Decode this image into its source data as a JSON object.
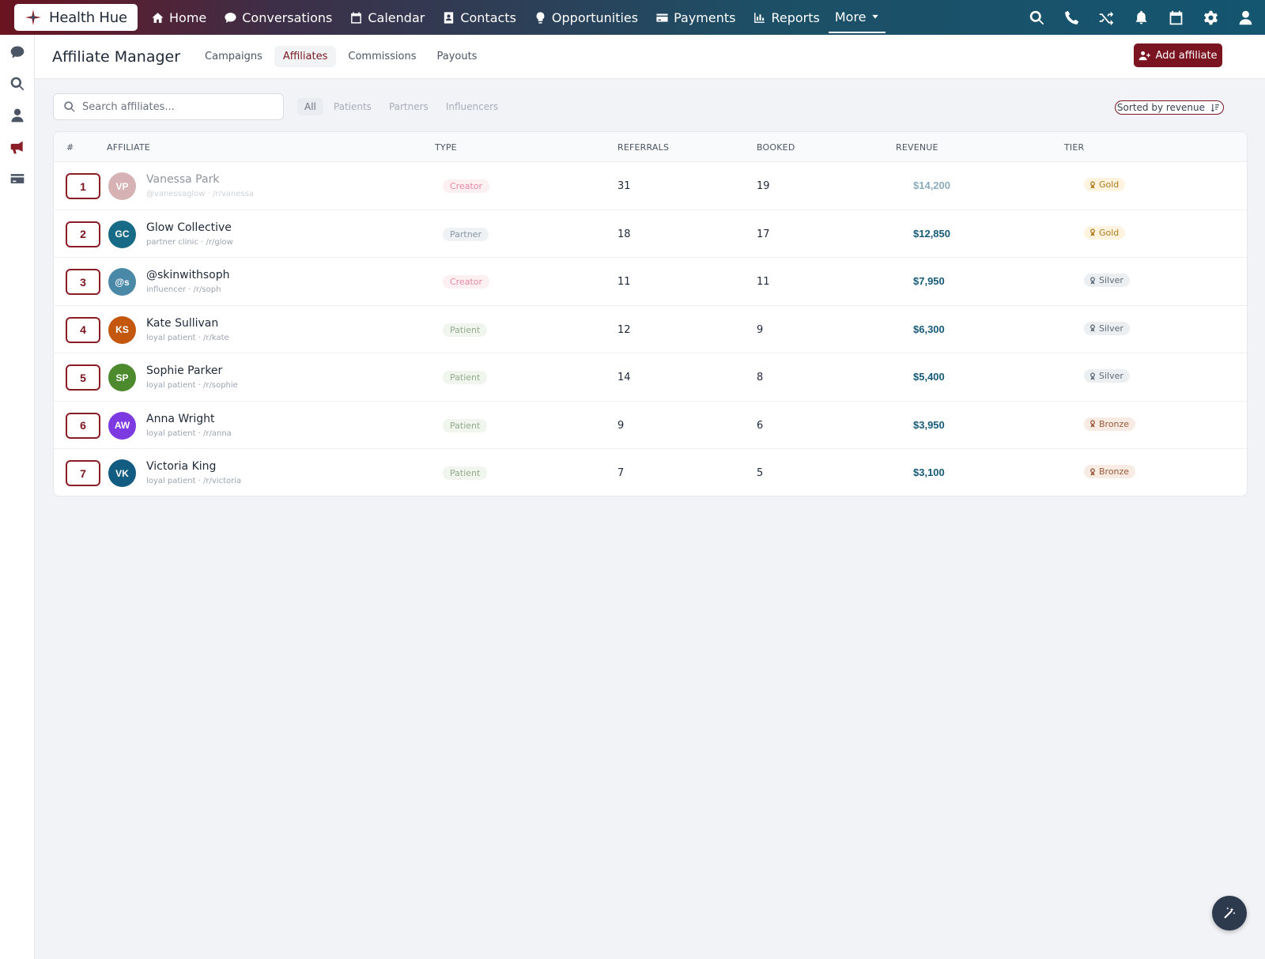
{
  "app": {
    "brand": "Health Hue",
    "accent": "#7a1420"
  },
  "nav": {
    "items": [
      {
        "label": "Home",
        "icon": "home-icon"
      },
      {
        "label": "Conversations",
        "icon": "chat-icon"
      },
      {
        "label": "Calendar",
        "icon": "calendar-icon"
      },
      {
        "label": "Contacts",
        "icon": "contact-card-icon"
      },
      {
        "label": "Opportunities",
        "icon": "lightbulb-icon"
      },
      {
        "label": "Payments",
        "icon": "credit-card-icon"
      },
      {
        "label": "Reports",
        "icon": "bar-chart-icon"
      }
    ],
    "more": "More",
    "right_icons": [
      "search-icon",
      "phone-icon",
      "shuffle-icon",
      "bell-icon",
      "calendar-icon",
      "gear-icon",
      "user-icon"
    ]
  },
  "siderail": {
    "icons": [
      "chat-icon",
      "search-icon",
      "user-icon",
      "megaphone-icon",
      "credit-card-icon"
    ],
    "active": "megaphone-icon"
  },
  "header": {
    "title": "Affiliate Manager",
    "tabs": [
      "Campaigns",
      "Affiliates",
      "Commissions",
      "Payouts"
    ],
    "active_tab": "Affiliates",
    "add_button": "Add affiliate"
  },
  "filters": {
    "search_placeholder": "Search affiliates...",
    "chips": [
      "All",
      "Patients",
      "Partners",
      "Influencers"
    ],
    "active_chip": "All",
    "sort_label": "Sorted by revenue"
  },
  "table": {
    "columns": [
      "#",
      "AFFILIATE",
      "TYPE",
      "REFERRALS",
      "BOOKED",
      "REVENUE",
      "TIER"
    ],
    "rows": [
      {
        "rank": "1",
        "initials": "VP",
        "avatar_color": "#b0676c",
        "name": "Vanessa Park",
        "sub": "@vanessaglow · /r/vanessa",
        "type": "Creator",
        "referrals": "31",
        "booked": "19",
        "revenue": "$14,200",
        "tier": "Gold"
      },
      {
        "rank": "2",
        "initials": "GC",
        "avatar_color": "#176b86",
        "name": "Glow Collective",
        "sub": "partner clinic · /r/glow",
        "type": "Partner",
        "referrals": "18",
        "booked": "17",
        "revenue": "$12,850",
        "tier": "Gold"
      },
      {
        "rank": "3",
        "initials": "@s",
        "avatar_color": "#4a88a8",
        "name": "@skinwithsoph",
        "sub": "influencer · /r/soph",
        "type": "Creator",
        "referrals": "11",
        "booked": "11",
        "revenue": "$7,950",
        "tier": "Silver"
      },
      {
        "rank": "4",
        "initials": "KS",
        "avatar_color": "#c4570e",
        "name": "Kate Sullivan",
        "sub": "loyal patient · /r/kate",
        "type": "Patient",
        "referrals": "12",
        "booked": "9",
        "revenue": "$6,300",
        "tier": "Silver"
      },
      {
        "rank": "5",
        "initials": "SP",
        "avatar_color": "#4c8a2d",
        "name": "Sophie Parker",
        "sub": "loyal patient · /r/sophie",
        "type": "Patient",
        "referrals": "14",
        "booked": "8",
        "revenue": "$5,400",
        "tier": "Silver"
      },
      {
        "rank": "6",
        "initials": "AW",
        "avatar_color": "#7c3ae0",
        "name": "Anna Wright",
        "sub": "loyal patient · /r/anna",
        "type": "Patient",
        "referrals": "9",
        "booked": "6",
        "revenue": "$3,950",
        "tier": "Bronze"
      },
      {
        "rank": "7",
        "initials": "VK",
        "avatar_color": "#115c80",
        "name": "Victoria King",
        "sub": "loyal patient · /r/victoria",
        "type": "Patient",
        "referrals": "7",
        "booked": "5",
        "revenue": "$3,100",
        "tier": "Bronze"
      }
    ]
  },
  "styles": {
    "type_colors": {
      "Creator": {
        "bg": "#fdf0f3",
        "fg": "#e38aa0"
      },
      "Partner": {
        "bg": "#eef2f4",
        "fg": "#8a98a3"
      },
      "Patient": {
        "bg": "#f0f6ee",
        "fg": "#93a88e"
      }
    },
    "tier_colors": {
      "Gold": {
        "bg": "#fdf3df",
        "fg": "#b27a1c"
      },
      "Silver": {
        "bg": "#eceff2",
        "fg": "#5f6b76"
      },
      "Bronze": {
        "bg": "#f8ebe3",
        "fg": "#9a5a3a"
      }
    }
  },
  "fab_icon": "magic-wand-icon"
}
